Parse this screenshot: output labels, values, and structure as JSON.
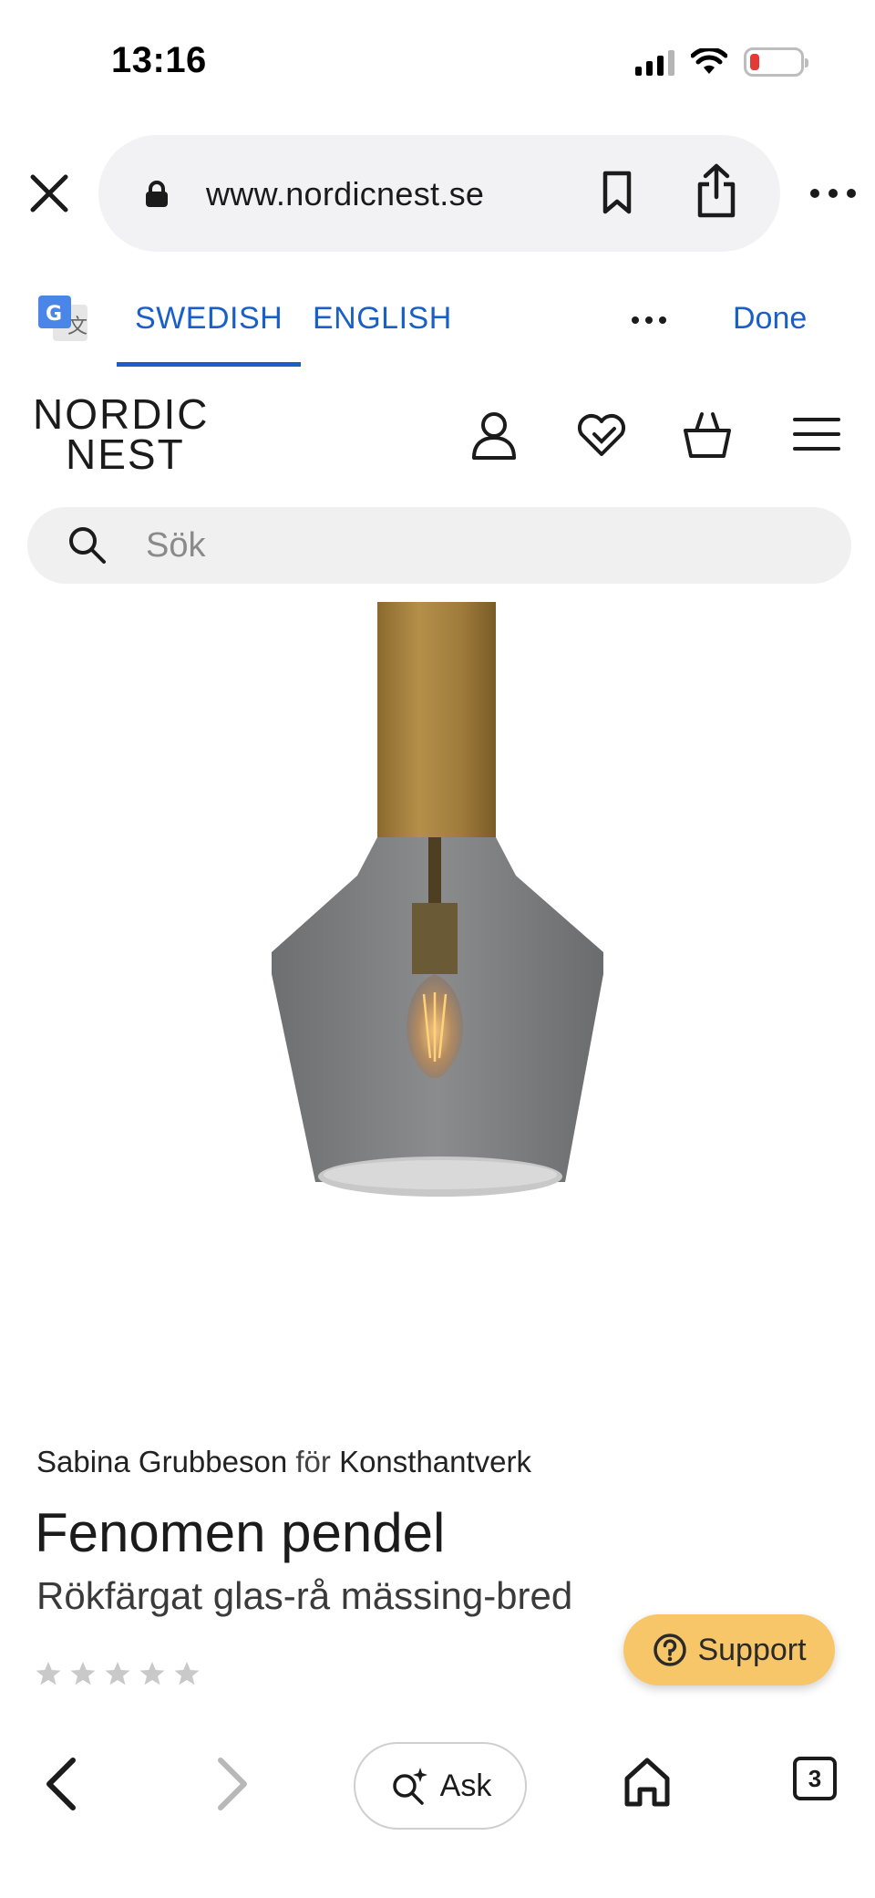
{
  "status_bar": {
    "time": "13:16",
    "battery_color": "#e53935"
  },
  "browser": {
    "url": "www.nordicnest.se",
    "icons": [
      "close-icon",
      "lock-icon",
      "bookmark-icon",
      "share-icon",
      "more-icon"
    ]
  },
  "translate": {
    "source_tab": "SWEDISH",
    "target_tab": "ENGLISH",
    "done_label": "Done",
    "accent": "#1a5fc8"
  },
  "site": {
    "logo_line1": "NORDIC",
    "logo_line2": "NEST",
    "header_icons": [
      "account-icon",
      "wishlist-heart-icon",
      "basket-icon",
      "menu-icon"
    ],
    "search_placeholder": "Sök"
  },
  "product": {
    "designer": "Sabina Grubbeson",
    "for_word": "för",
    "brand": "Konsthantverk",
    "title": "Fenomen pendel",
    "variant": "Rökfärgat glas-rå mässing-bred",
    "rating_stars": 0,
    "rating_max": 5
  },
  "support": {
    "label": "Support",
    "color": "#f7c668"
  },
  "bottom_nav": {
    "ask_label": "Ask",
    "tab_count": "3"
  }
}
